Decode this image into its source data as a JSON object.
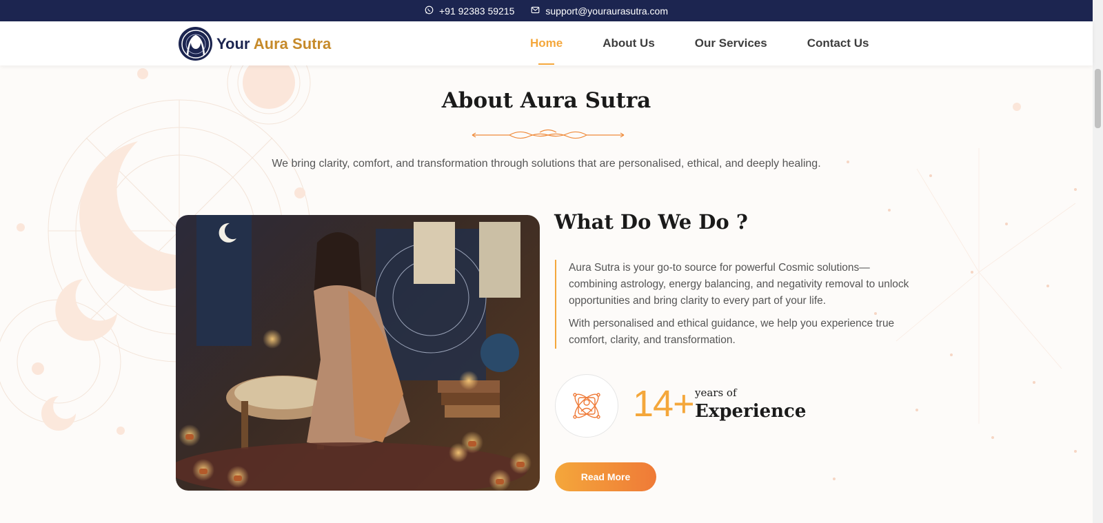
{
  "topbar": {
    "phone": "+91 92383 59215",
    "email": "support@youraurasutra.com",
    "phone_icon": "whatsapp-icon",
    "email_icon": "mail-icon"
  },
  "brand": {
    "name_prefix": "Your",
    "name_accent": "Aura Sutra",
    "logo_icon": "aura-face-logo"
  },
  "nav": {
    "items": [
      {
        "label": "Home",
        "active": true
      },
      {
        "label": "About Us",
        "active": false
      },
      {
        "label": "Our Services",
        "active": false
      },
      {
        "label": "Contact Us",
        "active": false
      }
    ]
  },
  "about": {
    "title": "About Aura Sutra",
    "subtitle": "We bring clarity, comfort, and transformation through solutions that are personalised, ethical, and deeply healing."
  },
  "what": {
    "title": "What Do We Do ?",
    "paragraph1": "Aura Sutra is your go-to source for powerful Cosmic solutions—combining astrology, energy balancing, and negativity removal to unlock opportunities and bring clarity to every part of your life.",
    "paragraph2": "With personalised and ethical guidance, we help you experience true comfort, clarity, and transformation."
  },
  "experience": {
    "number": "14+",
    "small_label": "years of",
    "big_label": "Experience",
    "icon": "spiritual-person-atom-icon"
  },
  "cta": {
    "read_more": "Read More"
  },
  "colors": {
    "navy": "#1c2550",
    "gold": "#c68a2a",
    "orange": "#f4a73b",
    "orange_dark": "#ef7a37"
  }
}
